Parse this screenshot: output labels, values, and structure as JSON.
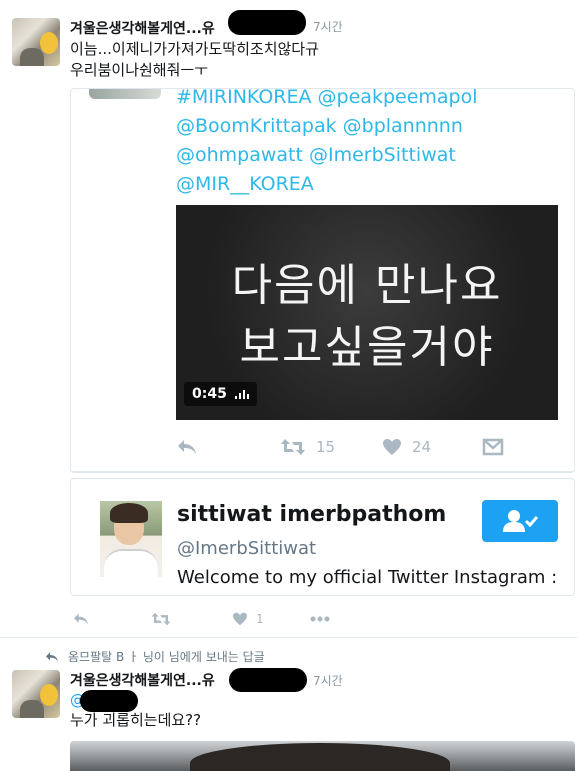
{
  "tweet1": {
    "author_name": "겨울은생각해볼게연...유",
    "time": "7시간",
    "text_line1": "이늠...이제니가가져가도딱히조치않다규",
    "text_line2": "우리붐이나숸해줘ㅡㅜ",
    "quoted": {
      "hashtags": [
        "#MIRINKOREA @peakpeemapol",
        "@BoomKrittapak @bplannnnn",
        "@ohmpawatt @ImerbSittiwat",
        "@MIR__KOREA"
      ],
      "video_text_line1": "다음에 만나요",
      "video_text_line2": "보고싶을거야",
      "video_duration": "0:45",
      "retweet_count": "15",
      "like_count": "24"
    },
    "user_card": {
      "name": "sittiwat imerbpathom",
      "handle": "@ImerbSittiwat",
      "bio": "Welcome to my official Twitter  Instagram :"
    },
    "like_count": "1"
  },
  "reply_context": "옴므팔탈 B ㅏ 닝이 님에게 보내는 답글",
  "tweet2": {
    "author_name": "겨울은생각해볼게연...유",
    "time": "7시간",
    "mention_prefix": "@",
    "text": "누가 괴롭히는데요??"
  },
  "colors": {
    "accent": "#1da1f2",
    "hashtag": "#2eb8e8",
    "muted": "#aab8c2",
    "border": "#e1e8ed"
  },
  "icons": [
    "reply-icon",
    "retweet-icon",
    "heart-icon",
    "dm-icon",
    "more-icon",
    "follow-icon"
  ]
}
